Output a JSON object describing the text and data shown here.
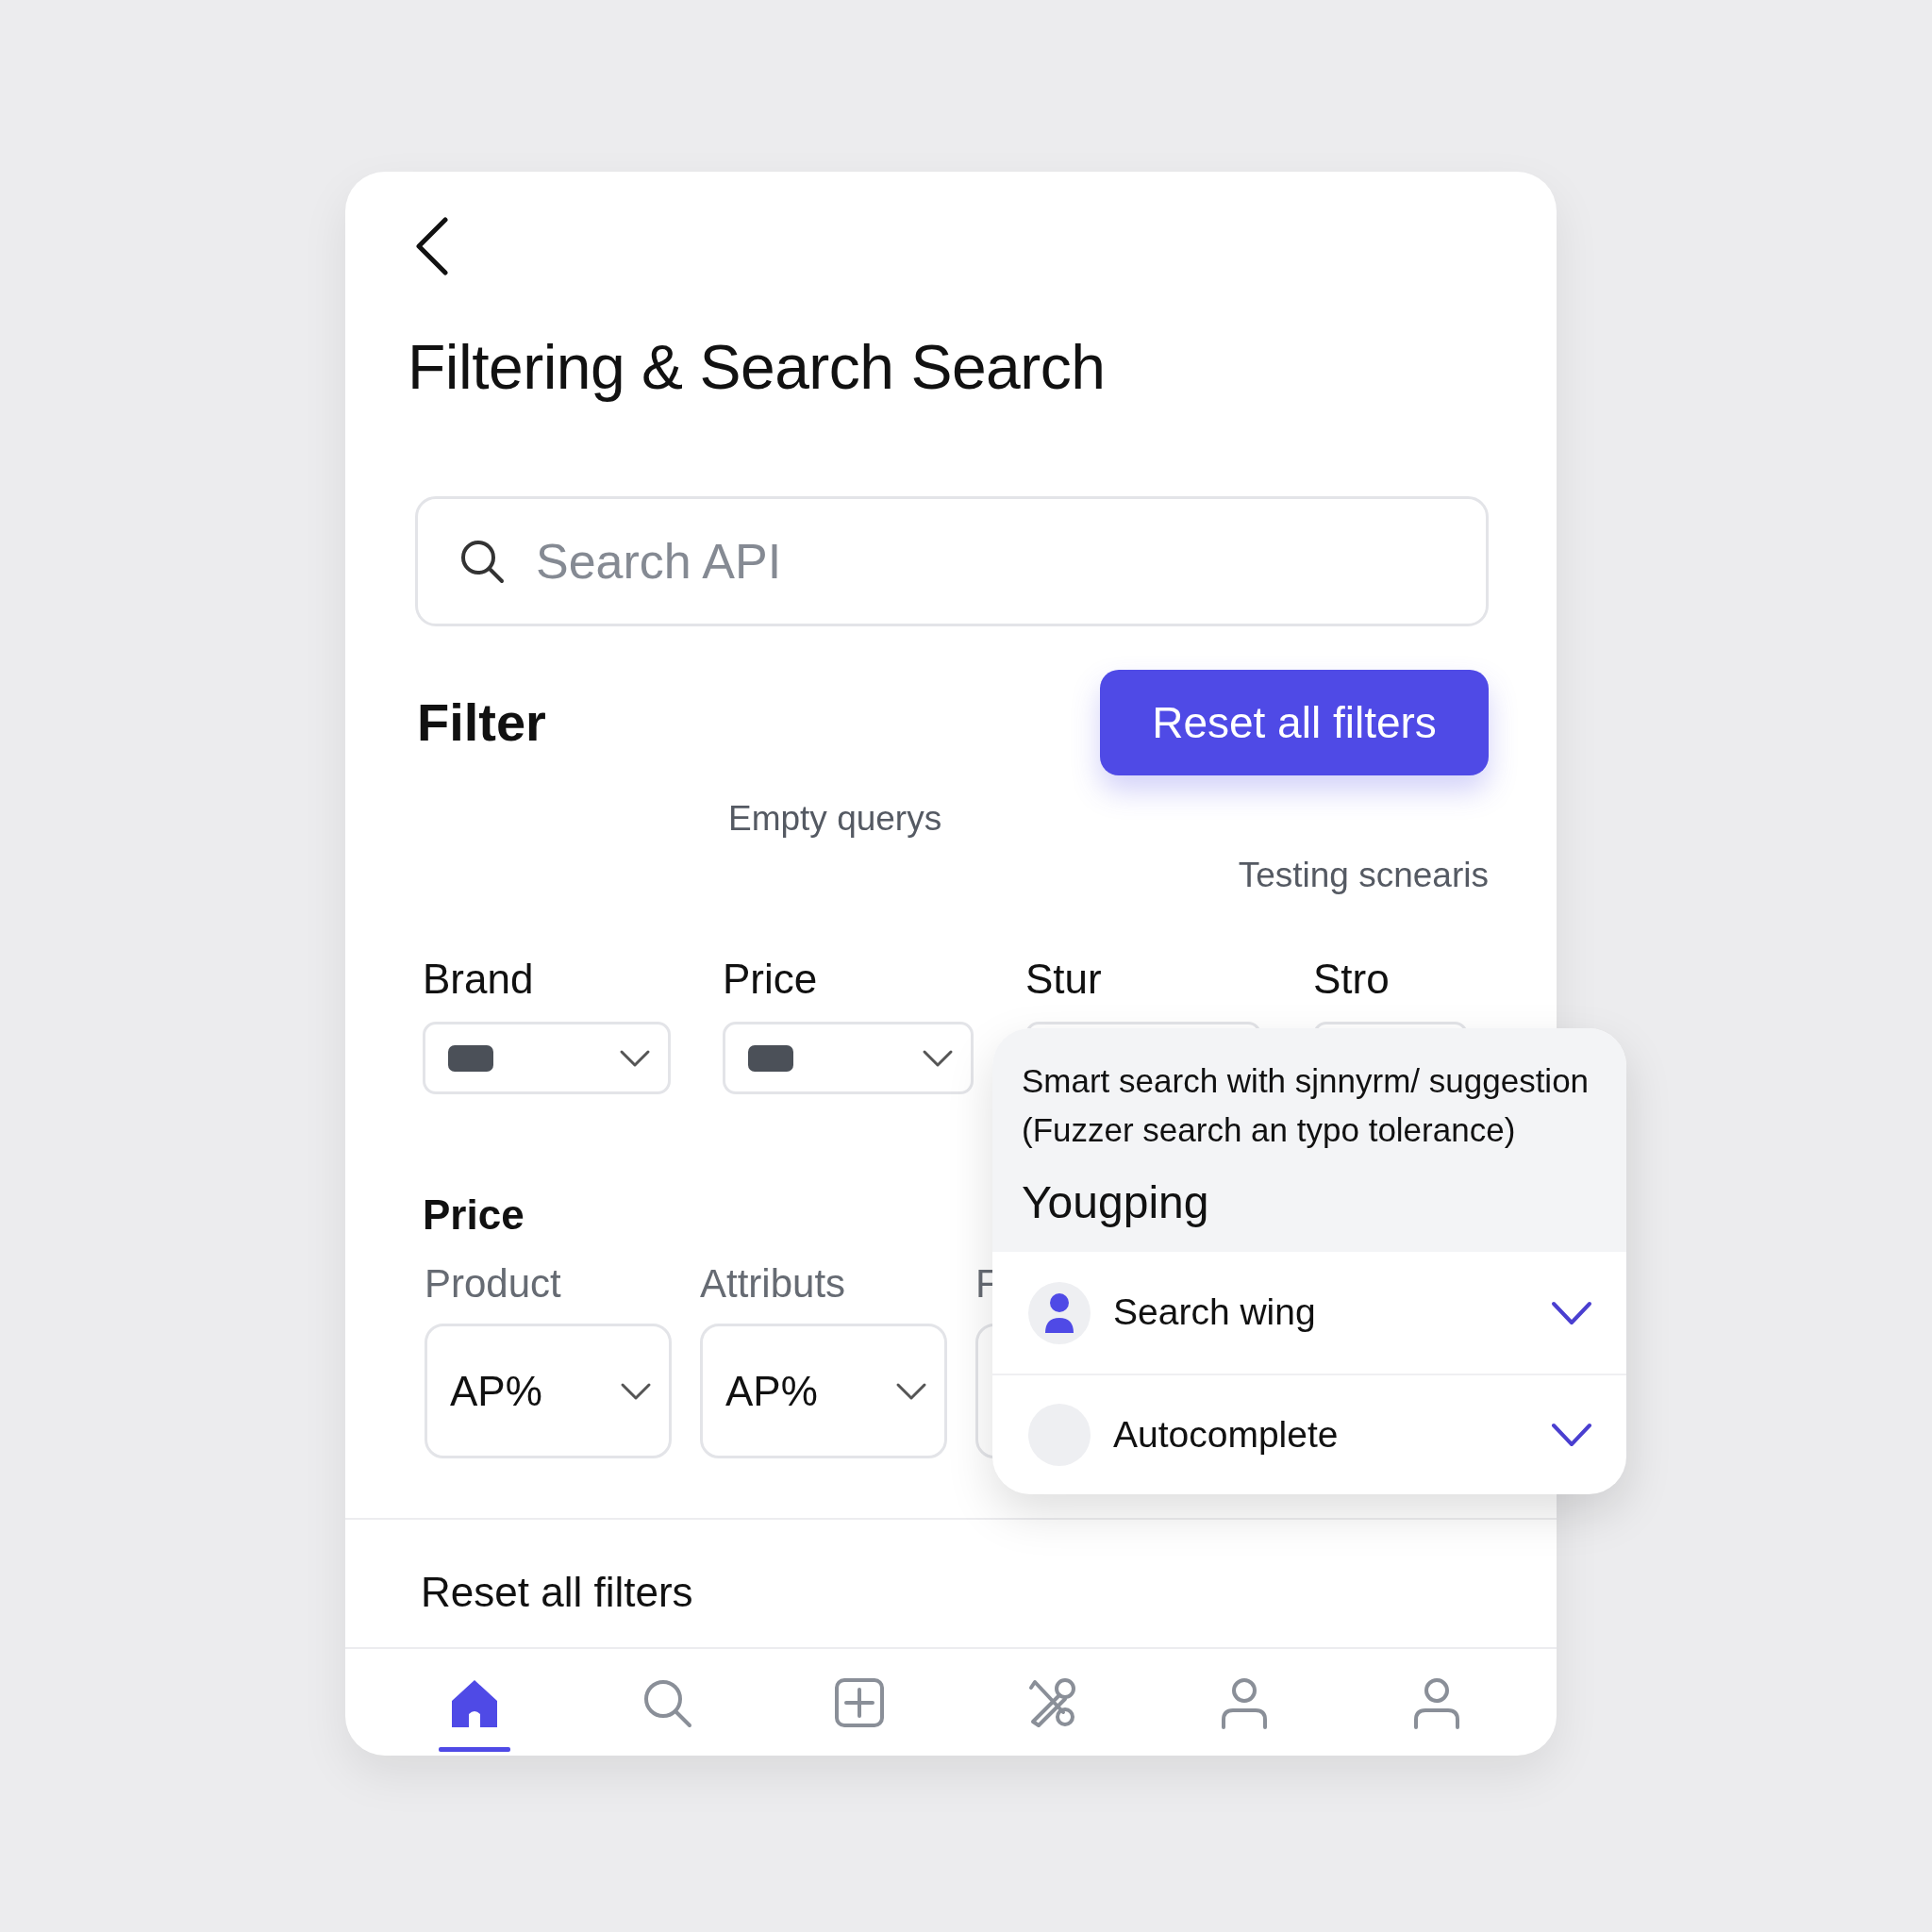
{
  "title": "Filtering & Search Search",
  "search": {
    "placeholder": "Search API"
  },
  "filter": {
    "heading": "Filter",
    "reset_button": "Reset all filters",
    "note_1": "Empty querys",
    "note_2": "Testing scnearis"
  },
  "selects_row_1": [
    {
      "label": "Brand",
      "kind": "swatch"
    },
    {
      "label": "Price",
      "kind": "swatch"
    },
    {
      "label": "Stur"
    },
    {
      "label": "Stro"
    }
  ],
  "price_section": {
    "heading": "Price",
    "fields": [
      {
        "label": "Product",
        "value": "AP%"
      },
      {
        "label": "Attributs",
        "value": "AP%"
      },
      {
        "label": "F"
      }
    ]
  },
  "footer_link": "Reset all filters",
  "popover": {
    "description": "Smart search with sjnnyrm/ suggestion (Fuzzer search an typo tolerance)",
    "heading": "Yougping",
    "items": [
      {
        "label": "Search wing",
        "kind": "person"
      },
      {
        "label": "Autocomplete",
        "kind": "empty"
      }
    ]
  },
  "nav": [
    {
      "kind": "home",
      "selected": true
    },
    {
      "kind": "search",
      "selected": false
    },
    {
      "kind": "add",
      "selected": false
    },
    {
      "kind": "tools",
      "selected": false
    },
    {
      "kind": "user",
      "selected": false
    },
    {
      "kind": "user",
      "selected": false
    }
  ]
}
